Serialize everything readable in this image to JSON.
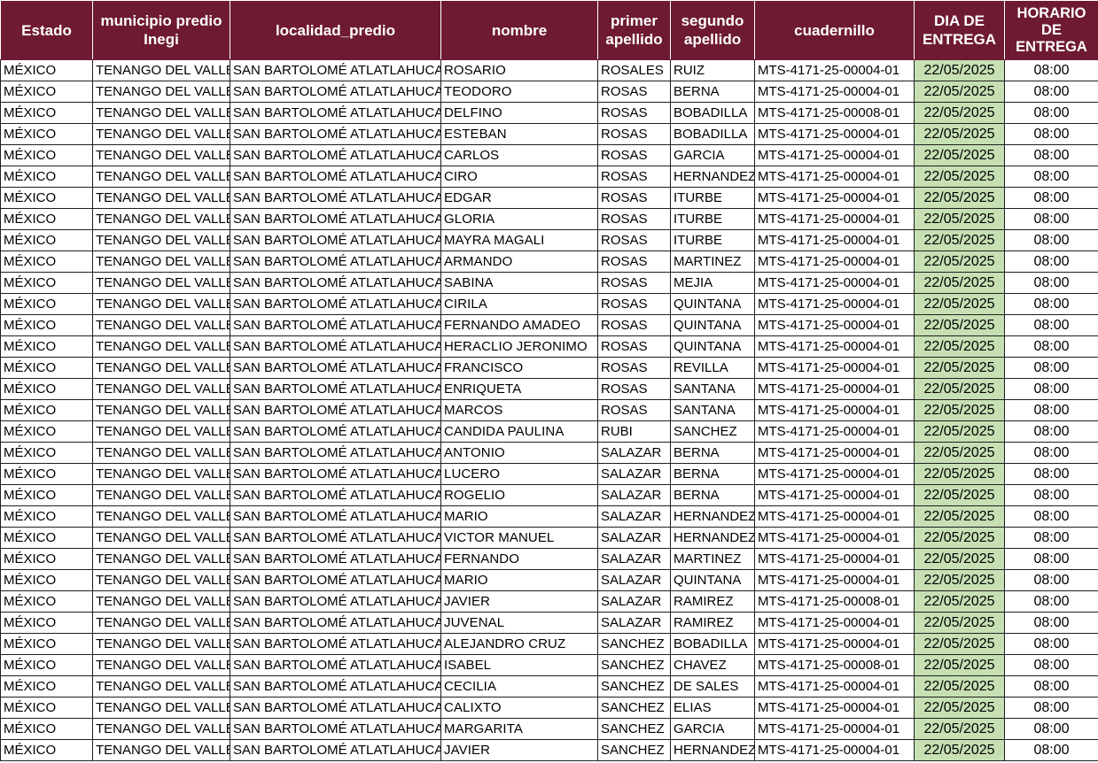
{
  "headers": {
    "estado": "Estado",
    "municipio": "municipio predio Inegi",
    "localidad": "localidad_predio",
    "nombre": "nombre",
    "primer_apellido": "primer apellido",
    "segundo_apellido": "segundo apellido",
    "cuadernillo": "cuadernillo",
    "dia_entrega": "DIA DE ENTREGA",
    "horario_entrega": "HORARIO DE ENTREGA"
  },
  "colors": {
    "header_background": "#6e1a32",
    "header_text": "#ffffff",
    "date_cell_background": "#c6e0b4"
  },
  "rows": [
    {
      "estado": "MÉXICO",
      "municipio": "TENANGO DEL VALLE",
      "localidad": "SAN BARTOLOMÉ ATLATLAHUCA",
      "nombre": "ROSARIO",
      "primer_apellido": "ROSALES",
      "segundo_apellido": "RUIZ",
      "cuadernillo": "MTS-4171-25-00004-01",
      "dia": "22/05/2025",
      "horario": "08:00"
    },
    {
      "estado": "MÉXICO",
      "municipio": "TENANGO DEL VALLE",
      "localidad": "SAN BARTOLOMÉ ATLATLAHUCA",
      "nombre": "TEODORO",
      "primer_apellido": "ROSAS",
      "segundo_apellido": "BERNA",
      "cuadernillo": "MTS-4171-25-00004-01",
      "dia": "22/05/2025",
      "horario": "08:00"
    },
    {
      "estado": "MÉXICO",
      "municipio": "TENANGO DEL VALLE",
      "localidad": "SAN BARTOLOMÉ ATLATLAHUCA",
      "nombre": "DELFINO",
      "primer_apellido": "ROSAS",
      "segundo_apellido": "BOBADILLA",
      "cuadernillo": "MTS-4171-25-00008-01",
      "dia": "22/05/2025",
      "horario": "08:00"
    },
    {
      "estado": "MÉXICO",
      "municipio": "TENANGO DEL VALLE",
      "localidad": "SAN BARTOLOMÉ ATLATLAHUCA",
      "nombre": "ESTEBAN",
      "primer_apellido": "ROSAS",
      "segundo_apellido": "BOBADILLA",
      "cuadernillo": "MTS-4171-25-00004-01",
      "dia": "22/05/2025",
      "horario": "08:00"
    },
    {
      "estado": "MÉXICO",
      "municipio": "TENANGO DEL VALLE",
      "localidad": "SAN BARTOLOMÉ ATLATLAHUCA",
      "nombre": "CARLOS",
      "primer_apellido": "ROSAS",
      "segundo_apellido": "GARCIA",
      "cuadernillo": "MTS-4171-25-00004-01",
      "dia": "22/05/2025",
      "horario": "08:00"
    },
    {
      "estado": "MÉXICO",
      "municipio": "TENANGO DEL VALLE",
      "localidad": "SAN BARTOLOMÉ ATLATLAHUCA",
      "nombre": "CIRO",
      "primer_apellido": "ROSAS",
      "segundo_apellido": "HERNANDEZ",
      "cuadernillo": "MTS-4171-25-00004-01",
      "dia": "22/05/2025",
      "horario": "08:00"
    },
    {
      "estado": "MÉXICO",
      "municipio": "TENANGO DEL VALLE",
      "localidad": "SAN BARTOLOMÉ ATLATLAHUCA",
      "nombre": "EDGAR",
      "primer_apellido": "ROSAS",
      "segundo_apellido": "ITURBE",
      "cuadernillo": "MTS-4171-25-00004-01",
      "dia": "22/05/2025",
      "horario": "08:00"
    },
    {
      "estado": "MÉXICO",
      "municipio": "TENANGO DEL VALLE",
      "localidad": "SAN BARTOLOMÉ ATLATLAHUCA",
      "nombre": "GLORIA",
      "primer_apellido": "ROSAS",
      "segundo_apellido": "ITURBE",
      "cuadernillo": "MTS-4171-25-00004-01",
      "dia": "22/05/2025",
      "horario": "08:00"
    },
    {
      "estado": "MÉXICO",
      "municipio": "TENANGO DEL VALLE",
      "localidad": "SAN BARTOLOMÉ ATLATLAHUCA",
      "nombre": "MAYRA MAGALI",
      "primer_apellido": "ROSAS",
      "segundo_apellido": "ITURBE",
      "cuadernillo": "MTS-4171-25-00004-01",
      "dia": "22/05/2025",
      "horario": "08:00"
    },
    {
      "estado": "MÉXICO",
      "municipio": "TENANGO DEL VALLE",
      "localidad": "SAN BARTOLOMÉ ATLATLAHUCA",
      "nombre": "ARMANDO",
      "primer_apellido": "ROSAS",
      "segundo_apellido": "MARTINEZ",
      "cuadernillo": "MTS-4171-25-00004-01",
      "dia": "22/05/2025",
      "horario": "08:00"
    },
    {
      "estado": "MÉXICO",
      "municipio": "TENANGO DEL VALLE",
      "localidad": "SAN BARTOLOMÉ ATLATLAHUCA",
      "nombre": "SABINA",
      "primer_apellido": "ROSAS",
      "segundo_apellido": "MEJIA",
      "cuadernillo": "MTS-4171-25-00004-01",
      "dia": "22/05/2025",
      "horario": "08:00"
    },
    {
      "estado": "MÉXICO",
      "municipio": "TENANGO DEL VALLE",
      "localidad": "SAN BARTOLOMÉ ATLATLAHUCA",
      "nombre": "CIRILA",
      "primer_apellido": "ROSAS",
      "segundo_apellido": "QUINTANA",
      "cuadernillo": "MTS-4171-25-00004-01",
      "dia": "22/05/2025",
      "horario": "08:00"
    },
    {
      "estado": "MÉXICO",
      "municipio": "TENANGO DEL VALLE",
      "localidad": "SAN BARTOLOMÉ ATLATLAHUCA",
      "nombre": "FERNANDO AMADEO",
      "primer_apellido": "ROSAS",
      "segundo_apellido": "QUINTANA",
      "cuadernillo": "MTS-4171-25-00004-01",
      "dia": "22/05/2025",
      "horario": "08:00"
    },
    {
      "estado": "MÉXICO",
      "municipio": "TENANGO DEL VALLE",
      "localidad": "SAN BARTOLOMÉ ATLATLAHUCA",
      "nombre": "HERACLIO JERONIMO",
      "primer_apellido": "ROSAS",
      "segundo_apellido": "QUINTANA",
      "cuadernillo": "MTS-4171-25-00004-01",
      "dia": "22/05/2025",
      "horario": "08:00"
    },
    {
      "estado": "MÉXICO",
      "municipio": "TENANGO DEL VALLE",
      "localidad": "SAN BARTOLOMÉ ATLATLAHUCA",
      "nombre": "FRANCISCO",
      "primer_apellido": "ROSAS",
      "segundo_apellido": "REVILLA",
      "cuadernillo": "MTS-4171-25-00004-01",
      "dia": "22/05/2025",
      "horario": "08:00"
    },
    {
      "estado": "MÉXICO",
      "municipio": "TENANGO DEL VALLE",
      "localidad": "SAN BARTOLOMÉ ATLATLAHUCA",
      "nombre": "ENRIQUETA",
      "primer_apellido": "ROSAS",
      "segundo_apellido": "SANTANA",
      "cuadernillo": "MTS-4171-25-00004-01",
      "dia": "22/05/2025",
      "horario": "08:00"
    },
    {
      "estado": "MÉXICO",
      "municipio": "TENANGO DEL VALLE",
      "localidad": "SAN BARTOLOMÉ ATLATLAHUCA",
      "nombre": "MARCOS",
      "primer_apellido": "ROSAS",
      "segundo_apellido": "SANTANA",
      "cuadernillo": "MTS-4171-25-00004-01",
      "dia": "22/05/2025",
      "horario": "08:00"
    },
    {
      "estado": "MÉXICO",
      "municipio": "TENANGO DEL VALLE",
      "localidad": "SAN BARTOLOMÉ ATLATLAHUCA",
      "nombre": "CANDIDA PAULINA",
      "primer_apellido": "RUBI",
      "segundo_apellido": "SANCHEZ",
      "cuadernillo": "MTS-4171-25-00004-01",
      "dia": "22/05/2025",
      "horario": "08:00"
    },
    {
      "estado": "MÉXICO",
      "municipio": "TENANGO DEL VALLE",
      "localidad": "SAN BARTOLOMÉ ATLATLAHUCA",
      "nombre": "ANTONIO",
      "primer_apellido": "SALAZAR",
      "segundo_apellido": "BERNA",
      "cuadernillo": "MTS-4171-25-00004-01",
      "dia": "22/05/2025",
      "horario": "08:00"
    },
    {
      "estado": "MÉXICO",
      "municipio": "TENANGO DEL VALLE",
      "localidad": "SAN BARTOLOMÉ ATLATLAHUCA",
      "nombre": "LUCERO",
      "primer_apellido": "SALAZAR",
      "segundo_apellido": "BERNA",
      "cuadernillo": "MTS-4171-25-00004-01",
      "dia": "22/05/2025",
      "horario": "08:00"
    },
    {
      "estado": "MÉXICO",
      "municipio": "TENANGO DEL VALLE",
      "localidad": "SAN BARTOLOMÉ ATLATLAHUCA",
      "nombre": "ROGELIO",
      "primer_apellido": "SALAZAR",
      "segundo_apellido": "BERNA",
      "cuadernillo": "MTS-4171-25-00004-01",
      "dia": "22/05/2025",
      "horario": "08:00"
    },
    {
      "estado": "MÉXICO",
      "municipio": "TENANGO DEL VALLE",
      "localidad": "SAN BARTOLOMÉ ATLATLAHUCA",
      "nombre": "MARIO",
      "primer_apellido": "SALAZAR",
      "segundo_apellido": "HERNANDEZ",
      "cuadernillo": "MTS-4171-25-00004-01",
      "dia": "22/05/2025",
      "horario": "08:00"
    },
    {
      "estado": "MÉXICO",
      "municipio": "TENANGO DEL VALLE",
      "localidad": "SAN BARTOLOMÉ ATLATLAHUCA",
      "nombre": "VICTOR MANUEL",
      "primer_apellido": "SALAZAR",
      "segundo_apellido": "HERNANDEZ",
      "cuadernillo": "MTS-4171-25-00004-01",
      "dia": "22/05/2025",
      "horario": "08:00"
    },
    {
      "estado": "MÉXICO",
      "municipio": "TENANGO DEL VALLE",
      "localidad": "SAN BARTOLOMÉ ATLATLAHUCA",
      "nombre": "FERNANDO",
      "primer_apellido": "SALAZAR",
      "segundo_apellido": "MARTINEZ",
      "cuadernillo": "MTS-4171-25-00004-01",
      "dia": "22/05/2025",
      "horario": "08:00"
    },
    {
      "estado": "MÉXICO",
      "municipio": "TENANGO DEL VALLE",
      "localidad": "SAN BARTOLOMÉ ATLATLAHUCA",
      "nombre": "MARIO",
      "primer_apellido": "SALAZAR",
      "segundo_apellido": "QUINTANA",
      "cuadernillo": "MTS-4171-25-00004-01",
      "dia": "22/05/2025",
      "horario": "08:00"
    },
    {
      "estado": "MÉXICO",
      "municipio": "TENANGO DEL VALLE",
      "localidad": "SAN BARTOLOMÉ ATLATLAHUCA",
      "nombre": "JAVIER",
      "primer_apellido": "SALAZAR",
      "segundo_apellido": "RAMIREZ",
      "cuadernillo": "MTS-4171-25-00008-01",
      "dia": "22/05/2025",
      "horario": "08:00"
    },
    {
      "estado": "MÉXICO",
      "municipio": "TENANGO DEL VALLE",
      "localidad": "SAN BARTOLOMÉ ATLATLAHUCA",
      "nombre": "JUVENAL",
      "primer_apellido": "SALAZAR",
      "segundo_apellido": "RAMIREZ",
      "cuadernillo": "MTS-4171-25-00004-01",
      "dia": "22/05/2025",
      "horario": "08:00"
    },
    {
      "estado": "MÉXICO",
      "municipio": "TENANGO DEL VALLE",
      "localidad": "SAN BARTOLOMÉ ATLATLAHUCA",
      "nombre": "ALEJANDRO CRUZ",
      "primer_apellido": "SANCHEZ",
      "segundo_apellido": "BOBADILLA",
      "cuadernillo": "MTS-4171-25-00004-01",
      "dia": "22/05/2025",
      "horario": "08:00"
    },
    {
      "estado": "MÉXICO",
      "municipio": "TENANGO DEL VALLE",
      "localidad": "SAN BARTOLOMÉ ATLATLAHUCA",
      "nombre": "ISABEL",
      "primer_apellido": "SANCHEZ",
      "segundo_apellido": "CHAVEZ",
      "cuadernillo": "MTS-4171-25-00008-01",
      "dia": "22/05/2025",
      "horario": "08:00"
    },
    {
      "estado": "MÉXICO",
      "municipio": "TENANGO DEL VALLE",
      "localidad": "SAN BARTOLOMÉ ATLATLAHUCA",
      "nombre": "CECILIA",
      "primer_apellido": "SANCHEZ",
      "segundo_apellido": "DE SALES",
      "cuadernillo": "MTS-4171-25-00004-01",
      "dia": "22/05/2025",
      "horario": "08:00"
    },
    {
      "estado": "MÉXICO",
      "municipio": "TENANGO DEL VALLE",
      "localidad": "SAN BARTOLOMÉ ATLATLAHUCA",
      "nombre": "CALIXTO",
      "primer_apellido": "SANCHEZ",
      "segundo_apellido": "ELIAS",
      "cuadernillo": "MTS-4171-25-00004-01",
      "dia": "22/05/2025",
      "horario": "08:00"
    },
    {
      "estado": "MÉXICO",
      "municipio": "TENANGO DEL VALLE",
      "localidad": "SAN BARTOLOMÉ ATLATLAHUCA",
      "nombre": "MARGARITA",
      "primer_apellido": "SANCHEZ",
      "segundo_apellido": "GARCIA",
      "cuadernillo": "MTS-4171-25-00004-01",
      "dia": "22/05/2025",
      "horario": "08:00"
    },
    {
      "estado": "MÉXICO",
      "municipio": "TENANGO DEL VALLE",
      "localidad": "SAN BARTOLOMÉ ATLATLAHUCA",
      "nombre": "JAVIER",
      "primer_apellido": "SANCHEZ",
      "segundo_apellido": "HERNANDEZ",
      "cuadernillo": "MTS-4171-25-00004-01",
      "dia": "22/05/2025",
      "horario": "08:00"
    }
  ]
}
